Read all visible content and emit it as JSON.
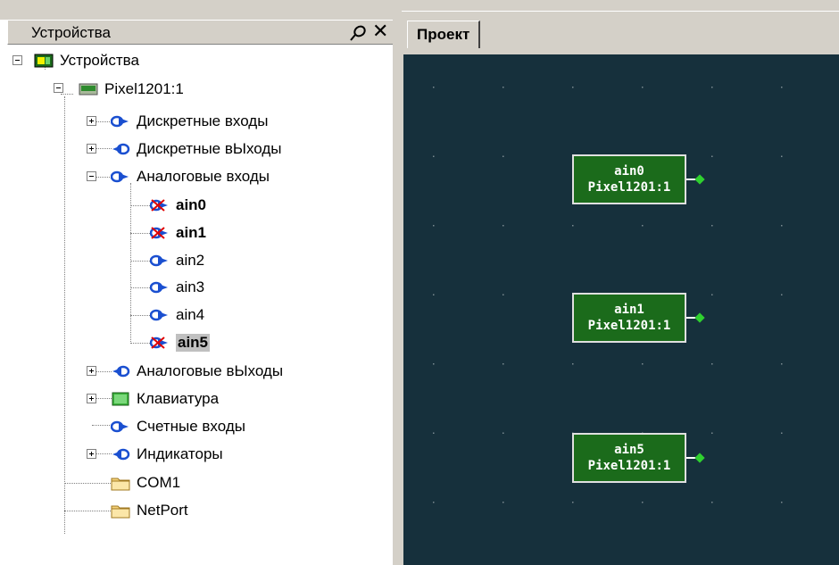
{
  "devices_panel": {
    "title": "Устройства",
    "pin_icon": "pin-icon",
    "close_glyph": "✕"
  },
  "tree": {
    "root": "Устройства",
    "device": "Pixel1201:1",
    "discrete_inputs": "Дискретные входы",
    "discrete_outputs": "Дискретные вЫходы",
    "analog_inputs": "Аналоговые входы",
    "ain0": "ain0",
    "ain1": "ain1",
    "ain2": "ain2",
    "ain3": "ain3",
    "ain4": "ain4",
    "ain5": "ain5",
    "analog_outputs": "Аналоговые вЫходы",
    "keyboard": "Клавиатура",
    "counter_inputs": "Счетные входы",
    "indicators": "Индикаторы",
    "com1": "COM1",
    "netport": "NetPort"
  },
  "project": {
    "tab_label": "Проект",
    "blocks": [
      {
        "name": "ain0",
        "device": "Pixel1201:1"
      },
      {
        "name": "ain1",
        "device": "Pixel1201:1"
      },
      {
        "name": "ain5",
        "device": "Pixel1201:1"
      }
    ]
  },
  "colors": {
    "canvas_bg": "#16303c",
    "block_bg": "#1b6b1b",
    "port": "#2fd02f",
    "panel_bg": "#d4d0c8"
  }
}
